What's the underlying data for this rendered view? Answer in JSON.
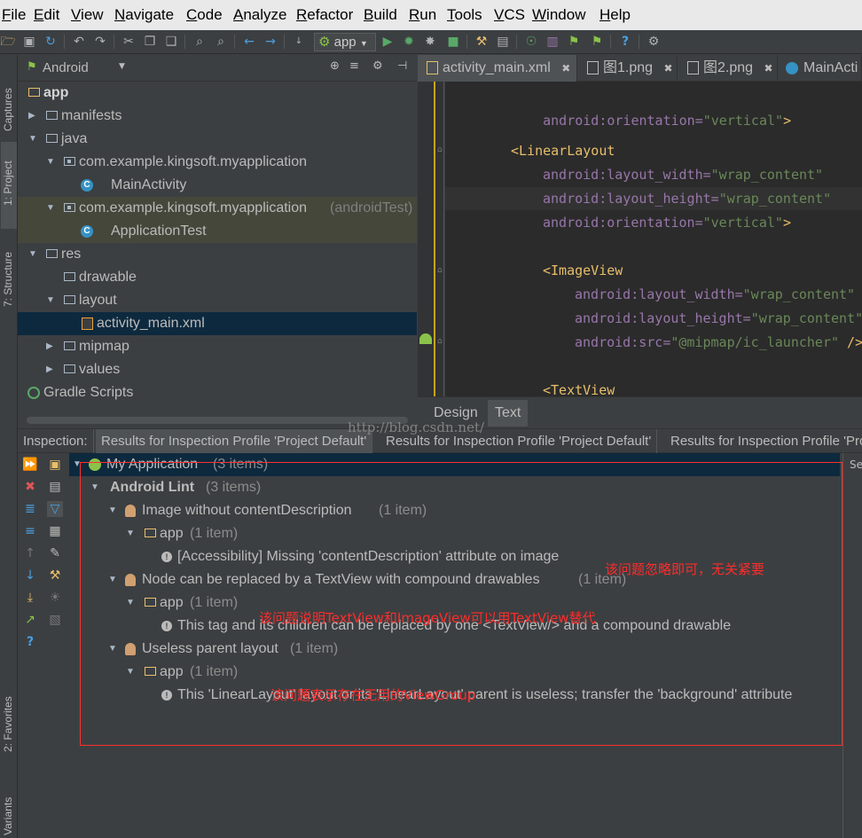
{
  "menu": [
    "File",
    "Edit",
    "View",
    "Navigate",
    "Code",
    "Analyze",
    "Refactor",
    "Build",
    "Run",
    "Tools",
    "VCS",
    "Window",
    "Help"
  ],
  "toolbar": {
    "run_config": "app"
  },
  "left_strip": {
    "captures": "Captures",
    "project": "1: Project",
    "structure": "7: Structure",
    "favorites": "2: Favorites",
    "variants": "Variants"
  },
  "project": {
    "view_selector": "Android",
    "tree": [
      {
        "label": "app",
        "level": 0
      },
      {
        "label": "manifests",
        "level": 1
      },
      {
        "label": "java",
        "level": 1
      },
      {
        "label": "com.example.kingsoft.myapplication",
        "level": 2
      },
      {
        "label": "MainActivity",
        "level": 3
      },
      {
        "label": "com.example.kingsoft.myapplication",
        "suffix": "(androidTest)",
        "level": 2
      },
      {
        "label": "ApplicationTest",
        "level": 3
      },
      {
        "label": "res",
        "level": 1
      },
      {
        "label": "drawable",
        "level": 2
      },
      {
        "label": "layout",
        "level": 2
      },
      {
        "label": "activity_main.xml",
        "level": 3
      },
      {
        "label": "mipmap",
        "level": 2
      },
      {
        "label": "values",
        "level": 2
      },
      {
        "label": "Gradle Scripts",
        "level": 0
      }
    ]
  },
  "editor": {
    "tabs": [
      "activity_main.xml",
      "图1.png",
      "图2.png",
      "MainActi"
    ],
    "code": {
      "l1_attr": "android:orientation=",
      "l1_val": "\"vertical\"",
      "l1_end": ">",
      "l2_tag": "<LinearLayout",
      "l3_attr": "android:layout_width=",
      "l3_val": "\"wrap_content\"",
      "l4_attr": "android:layout_height=",
      "l4_val": "\"wrap_content\"",
      "l5_attr": "android:orientation=",
      "l5_val": "\"vertical\"",
      "l5_end": ">",
      "l6_tag": "<ImageView",
      "l7_attr": "android:layout_width=",
      "l7_val": "\"wrap_content\"",
      "l8_attr": "android:layout_height=",
      "l8_val": "\"wrap_content\"",
      "l9_attr": "android:src=",
      "l9_val": "\"@mipmap/ic_launcher\"",
      "l9_end": " />",
      "l10_tag": "<TextView"
    },
    "design_tab": "Design",
    "text_tab": "Text"
  },
  "watermark": "http://blog.csdn.net/",
  "inspection": {
    "label": "Inspection:",
    "tabs": [
      "Results for Inspection Profile 'Project Default'",
      "Results for Inspection Profile 'Project Default'",
      "Results for Inspection Profile 'Pro"
    ],
    "tree": {
      "root": "My Application",
      "root_count": "(3 items)",
      "lint": "Android Lint",
      "lint_count": "(3 items)",
      "g1": "Image without contentDescription",
      "g1_count": "(1 item)",
      "g1_app": "app",
      "g1_app_count": "(1 item)",
      "g1_msg": "[Accessibility] Missing 'contentDescription' attribute on image",
      "g2": "Node can be replaced by a TextView with compound drawables",
      "g2_count": "(1 item)",
      "g2_app": "app",
      "g2_app_count": "(1 item)",
      "g2_msg": "This tag and its children can be replaced by one <TextView/> and a compound drawable",
      "g3": "Useless parent layout",
      "g3_count": "(1 item)",
      "g3_app": "app",
      "g3_app_count": "(1 item)",
      "g3_msg": "This 'LinearLayout' layout or its 'LinearLayout' parent is useless; transfer the 'background' attribute"
    },
    "right_label": "Se"
  },
  "annotations": {
    "a1": "该问题忽略即可，无关紧要",
    "a2": "该问题说明TextView和ImageView可以用TextView替代",
    "a3": "该问题表示存在无用的ViewGroup"
  },
  "colors": {
    "annotation": "#ff2b2b",
    "selection": "#0d293e",
    "background": "#3c3f41"
  }
}
